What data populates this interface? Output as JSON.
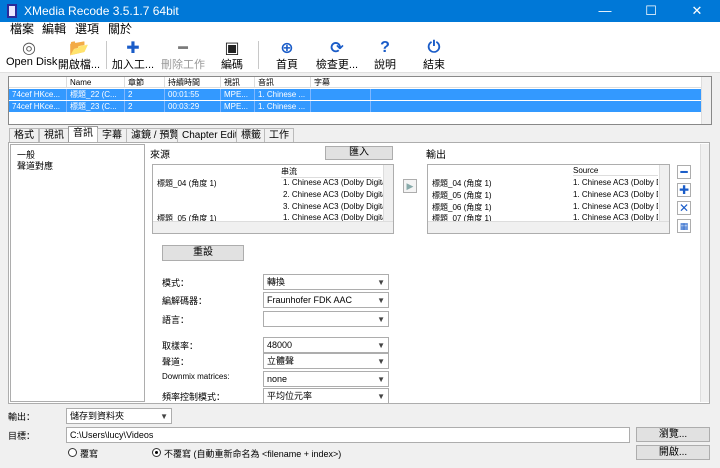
{
  "window": {
    "title": "XMedia Recode 3.5.1.7 64bit",
    "minimize": "—",
    "maximize": "☐",
    "close": "✕"
  },
  "menu": [
    "檔案",
    "編輯",
    "選項",
    "關於"
  ],
  "toolbar": [
    {
      "label": "Open Disk",
      "icon": "disc-icon",
      "glyph": "◎",
      "color": "#555555"
    },
    {
      "label": "開啟檔...",
      "icon": "folder-icon",
      "glyph": "📂",
      "color": "#d4a017"
    },
    {
      "label": "加入工...",
      "icon": "plus-icon",
      "glyph": "✚",
      "color": "#1a5cc8"
    },
    {
      "label": "刪除工作",
      "icon": "minus-icon",
      "glyph": "━",
      "color": "#7a7a7a"
    },
    {
      "label": "編碼",
      "icon": "film-icon",
      "glyph": "▣",
      "color": "#222222"
    },
    {
      "label": "首頁",
      "icon": "globe-icon",
      "glyph": "⊕",
      "color": "#1a5cc8"
    },
    {
      "label": "檢查更...",
      "icon": "refresh-icon",
      "glyph": "⟳",
      "color": "#1a5cc8"
    },
    {
      "label": "說明",
      "icon": "help-icon",
      "glyph": "?",
      "color": "#1a5cc8"
    },
    {
      "label": "結束",
      "icon": "power-icon",
      "glyph": "⏻",
      "color": "#1a5cc8"
    }
  ],
  "joblist": {
    "columns": [
      "",
      "Name",
      "章節",
      "持續時間",
      "視訊",
      "音訊",
      "字幕"
    ],
    "rows": [
      [
        "74cef HKce...",
        "標題_22 (C...",
        "2",
        "00:01:55",
        "MPE...",
        "1. Chinese ...",
        ""
      ],
      [
        "74cef HKce...",
        "標題_23 (C...",
        "2",
        "00:03:29",
        "MPE...",
        "1. Chinese ...",
        ""
      ]
    ]
  },
  "tabs": [
    "格式",
    "視訊",
    "音訊",
    "字幕",
    "濾鏡 / 預覽",
    "Chapter Editor",
    "標籤",
    "工作"
  ],
  "left_list": [
    "一般",
    "聲道對應"
  ],
  "source": {
    "label": "來源",
    "import_button": "匯入",
    "column_stream": "串流",
    "rows": [
      [
        "標題_04 (角度 1)",
        "1. Chinese AC3 (Dolby Digital"
      ],
      [
        "",
        "2. Chinese AC3 (Dolby Digital"
      ],
      [
        "",
        "3. Chinese AC3 (Dolby Digital"
      ],
      [
        "標題_05 (角度 1)",
        "1. Chinese AC3 (Dolby Digital"
      ]
    ]
  },
  "output": {
    "label": "輸出",
    "column_source": "Source",
    "rows": [
      [
        "標題_04 (角度 1)",
        "1. Chinese AC3 (Dolby Di"
      ],
      [
        "標題_05 (角度 1)",
        "1. Chinese AC3 (Dolby Di"
      ],
      [
        "標題_06 (角度 1)",
        "1. Chinese AC3 (Dolby Di"
      ],
      [
        "標題_07 (角度 1)",
        "1. Chinese AC3 (Dolby Di"
      ]
    ]
  },
  "reset_button": "重設",
  "settings": [
    {
      "label": "模式：",
      "value": "轉換"
    },
    {
      "label": "編解碼器：",
      "value": "Fraunhofer FDK AAC"
    },
    {
      "label": "語言：",
      "value": ""
    },
    {
      "label": "取樣率：",
      "value": "48000"
    },
    {
      "label": "聲道：",
      "value": "立體聲"
    },
    {
      "label": "Downmix matrices:",
      "value": "none"
    },
    {
      "label": "頻率控制模式：",
      "value": "平均位元率"
    }
  ],
  "bottom": {
    "output_label": "輸出：",
    "output_value": "儲存到資料夾",
    "target_label": "目標：",
    "target_path": "C:\\Users\\lucy\\Videos",
    "browse_button": "瀏覽...",
    "open_button": "開啟...",
    "overwrite": "覆寫",
    "no_overwrite": "不覆寫 (自動重新命名為 <filename + index>)"
  },
  "colors": {
    "titlebar": "#0078d7",
    "selection": "#3399ff",
    "accent": "#1a5cc8"
  }
}
